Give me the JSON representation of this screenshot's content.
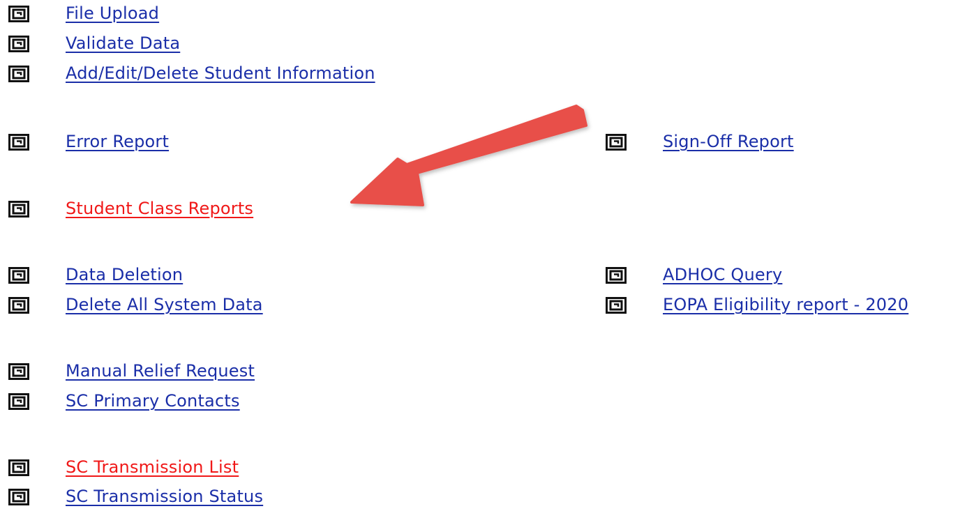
{
  "icon": "square-spiral-icon",
  "colors": {
    "link": "#1a2ea8",
    "link_highlight": "#f01818",
    "arrow": "#e8504a",
    "icon": "#111111"
  },
  "left_column": [
    {
      "label": "File Upload",
      "style": "normal"
    },
    {
      "label": "Validate Data",
      "style": "normal"
    },
    {
      "label": "Add/Edit/Delete Student Information",
      "style": "normal"
    },
    {
      "label": "Error Report",
      "style": "normal"
    },
    {
      "label": "Student Class Reports",
      "style": "highlight"
    },
    {
      "label": "Data Deletion",
      "style": "normal"
    },
    {
      "label": "Delete All System Data",
      "style": "normal"
    },
    {
      "label": "Manual Relief Request",
      "style": "normal"
    },
    {
      "label": "SC Primary Contacts",
      "style": "normal"
    },
    {
      "label": "SC Transmission List",
      "style": "highlight"
    },
    {
      "label": "SC Transmission Status",
      "style": "normal"
    }
  ],
  "right_column": [
    {
      "label": "Sign-Off Report",
      "style": "normal"
    },
    {
      "label": "ADHOC Query",
      "style": "normal"
    },
    {
      "label": "EOPA Eligibility report - 2020",
      "style": "normal"
    }
  ]
}
